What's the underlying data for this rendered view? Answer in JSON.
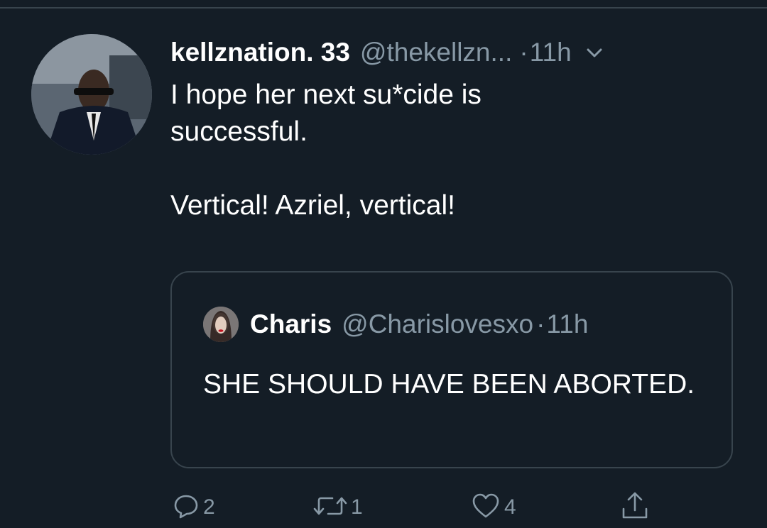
{
  "tweet": {
    "display_name": "kellznation. 33",
    "handle": "@thekellzn...",
    "separator": "·",
    "time": "11h",
    "text_line1": "I hope her next su*cide is successful.",
    "text_line2": "Vertical! Azriel, vertical!"
  },
  "quoted": {
    "display_name": "Charis",
    "handle": "@Charislovesxo",
    "separator": "·",
    "time": "11h",
    "text": "SHE SHOULD HAVE BEEN ABORTED."
  },
  "actions": {
    "reply_count": "2",
    "retweet_count": "1",
    "like_count": "4"
  },
  "colors": {
    "background": "#141d26",
    "text": "#ffffff",
    "secondary_text": "#8899a6",
    "border": "#38444d"
  },
  "icons": [
    "chevron-down-icon",
    "reply-icon",
    "retweet-icon",
    "like-icon",
    "share-icon"
  ]
}
